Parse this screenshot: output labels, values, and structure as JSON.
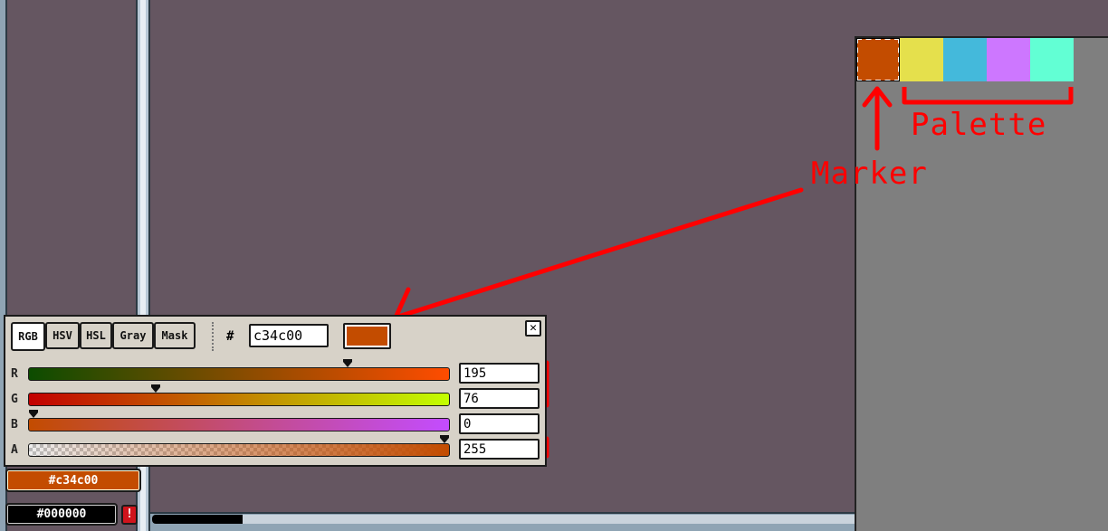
{
  "palette": {
    "swatches": [
      {
        "color": "#c34c00",
        "selected": true
      },
      {
        "color": "#e5e04c"
      },
      {
        "color": "#44b9db"
      },
      {
        "color": "#cd77ff"
      },
      {
        "color": "#62ffd4"
      }
    ]
  },
  "annotations": {
    "palette_label": "Palette",
    "marker_label": "Marker",
    "color": "#ff0000"
  },
  "color_picker": {
    "tabs": [
      {
        "label": "RGB",
        "active": true
      },
      {
        "label": "HSV"
      },
      {
        "label": "HSL"
      },
      {
        "label": "Gray"
      },
      {
        "label": "Mask"
      }
    ],
    "hash_label": "#",
    "hex_value": "c34c00",
    "preview_color": "#c34c00",
    "close_glyph": "✕",
    "channels": [
      {
        "label": "R",
        "value": "195",
        "fraction": 0.7647
      },
      {
        "label": "G",
        "value": "76",
        "fraction": 0.298
      },
      {
        "label": "B",
        "value": "0",
        "fraction": 0.0
      },
      {
        "label": "A",
        "value": "255",
        "fraction": 1.0
      }
    ]
  },
  "color_bar": {
    "foreground_label": "#c34c00",
    "foreground_color": "#c34c00",
    "background_label": "#000000",
    "background_color": "#000000",
    "warning_icon": "!"
  }
}
